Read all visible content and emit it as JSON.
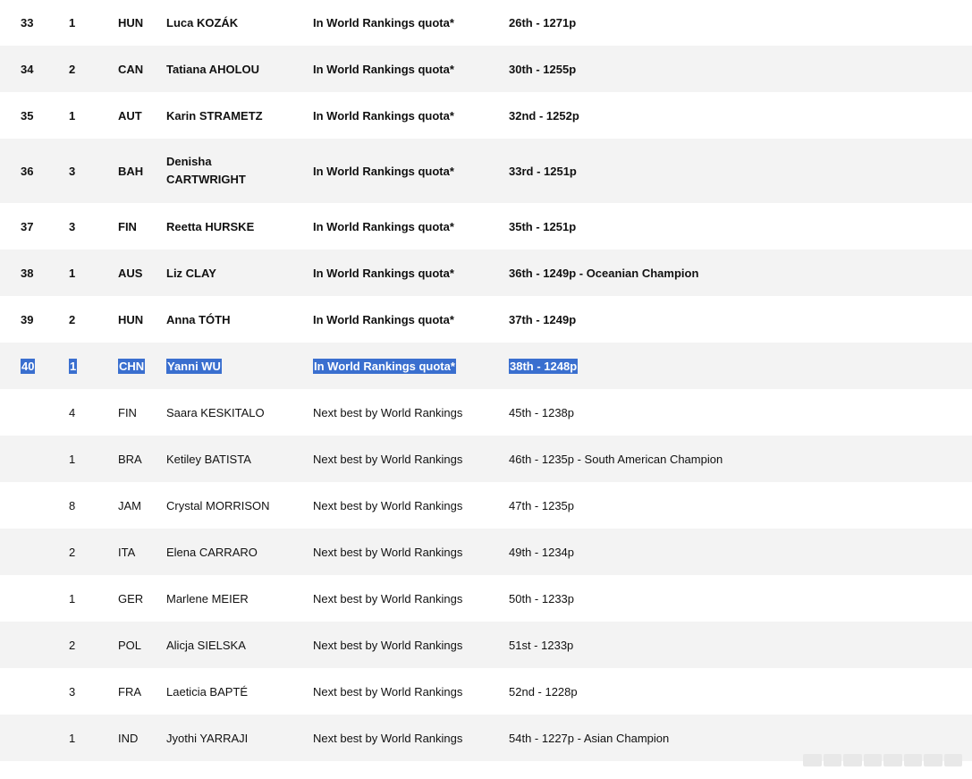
{
  "rows": [
    {
      "pos": "33",
      "rank": "1",
      "nat": "HUN",
      "name": "Luca KOZÁK",
      "qual": "In World Rankings quota*",
      "wr": "26th - 1271p"
    },
    {
      "pos": "34",
      "rank": "2",
      "nat": "CAN",
      "name": "Tatiana AHOLOU",
      "qual": "In World Rankings quota*",
      "wr": "30th - 1255p"
    },
    {
      "pos": "35",
      "rank": "1",
      "nat": "AUT",
      "name": "Karin STRAMETZ",
      "qual": "In World Rankings quota*",
      "wr": "32nd - 1252p"
    },
    {
      "pos": "36",
      "rank": "3",
      "nat": "BAH",
      "name": "Denisha CARTWRIGHT",
      "qual": "In World Rankings quota*",
      "wr": "33rd - 1251p"
    },
    {
      "pos": "37",
      "rank": "3",
      "nat": "FIN",
      "name": "Reetta HURSKE",
      "qual": "In World Rankings quota*",
      "wr": "35th - 1251p"
    },
    {
      "pos": "38",
      "rank": "1",
      "nat": "AUS",
      "name": "Liz CLAY",
      "qual": "In World Rankings quota*",
      "wr": "36th - 1249p - Oceanian Champion"
    },
    {
      "pos": "39",
      "rank": "2",
      "nat": "HUN",
      "name": "Anna TÓTH",
      "qual": "In World Rankings quota*",
      "wr": "37th - 1249p"
    },
    {
      "pos": "40",
      "rank": "1",
      "nat": "CHN",
      "name": "Yanni WU",
      "qual": "In World Rankings quota*",
      "wr": "38th - 1248p"
    },
    {
      "pos": "",
      "rank": "4",
      "nat": "FIN",
      "name": "Saara KESKITALO",
      "qual": "Next best by World Rankings",
      "wr": "45th - 1238p"
    },
    {
      "pos": "",
      "rank": "1",
      "nat": "BRA",
      "name": "Ketiley BATISTA",
      "qual": "Next best by World Rankings",
      "wr": "46th - 1235p - South American Champion"
    },
    {
      "pos": "",
      "rank": "8",
      "nat": "JAM",
      "name": "Crystal MORRISON",
      "qual": "Next best by World Rankings",
      "wr": "47th - 1235p"
    },
    {
      "pos": "",
      "rank": "2",
      "nat": "ITA",
      "name": "Elena CARRARO",
      "qual": "Next best by World Rankings",
      "wr": "49th - 1234p"
    },
    {
      "pos": "",
      "rank": "1",
      "nat": "GER",
      "name": "Marlene MEIER",
      "qual": "Next best by World Rankings",
      "wr": "50th - 1233p"
    },
    {
      "pos": "",
      "rank": "2",
      "nat": "POL",
      "name": "Alicja SIELSKA",
      "qual": "Next best by World Rankings",
      "wr": "51st - 1233p"
    },
    {
      "pos": "",
      "rank": "3",
      "nat": "FRA",
      "name": "Laeticia BAPTÉ",
      "qual": "Next best by World Rankings",
      "wr": "52nd - 1228p"
    },
    {
      "pos": "",
      "rank": "1",
      "nat": "IND",
      "name": "Jyothi YARRAJI",
      "qual": "Next best by World Rankings",
      "wr": "54th - 1227p - Asian Champion"
    }
  ]
}
